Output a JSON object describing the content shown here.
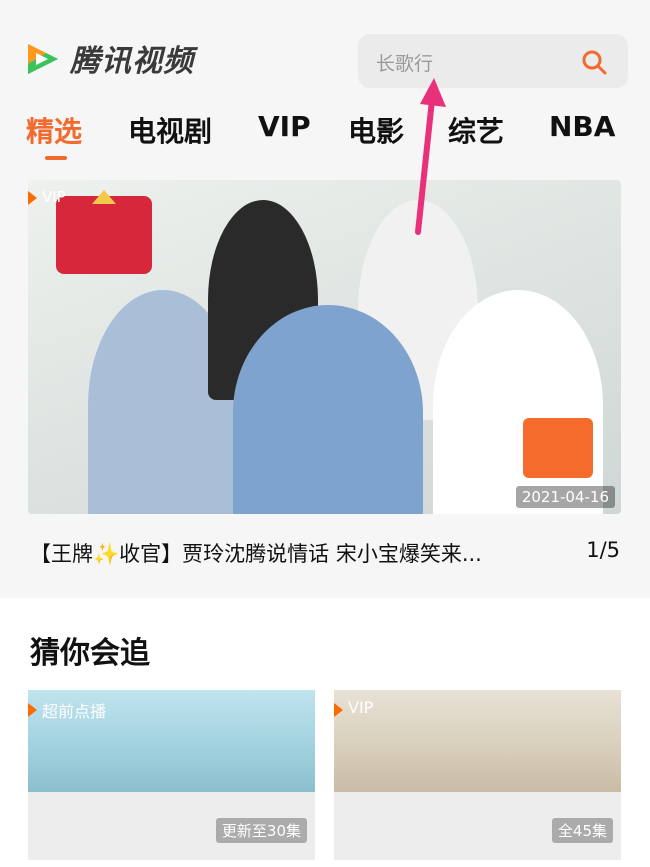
{
  "header": {
    "brand": "腾讯视频",
    "search_placeholder": "长歌行"
  },
  "tabs": [
    {
      "label": "精选",
      "active": true
    },
    {
      "label": "电视剧"
    },
    {
      "label": "VIP"
    },
    {
      "label": "电影"
    },
    {
      "label": "综艺"
    },
    {
      "label": "NBA"
    }
  ],
  "banner": {
    "badge": "VIP",
    "date": "2021-04-16",
    "caption": "【王牌✨收官】贾玲沈腾说情话 宋小宝爆笑来...",
    "page_indicator": "1/5"
  },
  "section": {
    "title": "猜你会追",
    "cards": [
      {
        "badge": "超前点播",
        "status": "更新至30集"
      },
      {
        "badge": "VIP",
        "status": "全45集"
      }
    ]
  },
  "colors": {
    "accent": "#f26a2f",
    "arrow": "#e8317a"
  }
}
